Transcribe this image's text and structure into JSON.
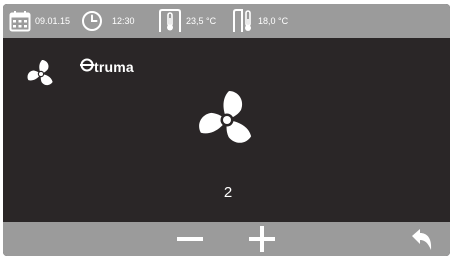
{
  "status": {
    "date": "09.01.15",
    "time": "12:30",
    "inside_temp": "23,5 °C",
    "outside_temp": "18,0 °C"
  },
  "header": {
    "mode_icon": "fan-icon",
    "brand": "truma"
  },
  "main": {
    "center_icon": "fan-icon",
    "fan_level": "2"
  },
  "controls": {
    "decrease_icon": "minus-icon",
    "increase_icon": "plus-icon",
    "back_icon": "back-arrow-icon"
  },
  "colors": {
    "bar": "#9b9b9b",
    "background": "#2a2627",
    "foreground": "#ffffff"
  }
}
